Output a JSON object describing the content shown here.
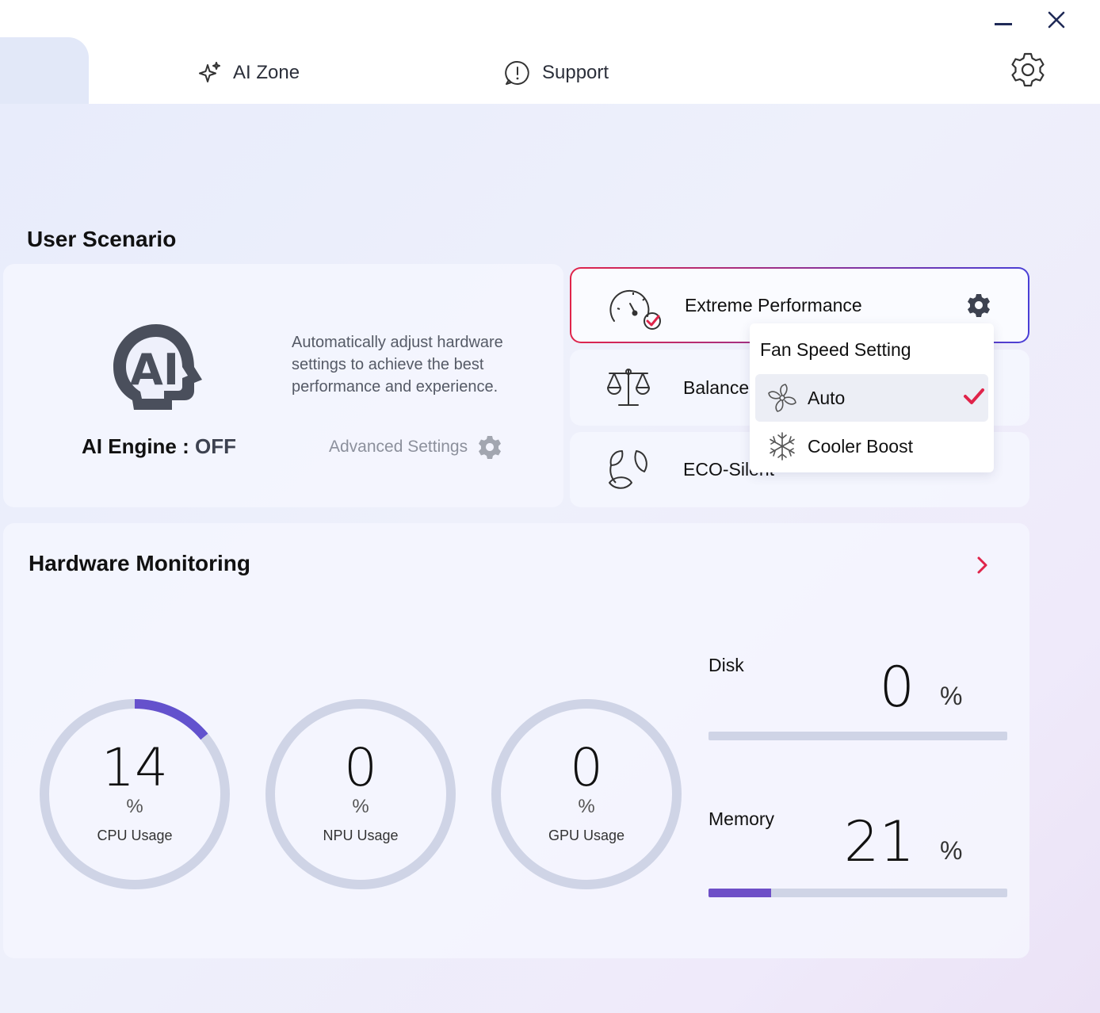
{
  "nav": {
    "tabs": [
      {
        "label": "AI Zone",
        "icon": "sparkle-icon"
      },
      {
        "label": "Support",
        "icon": "chat-alert-icon"
      }
    ]
  },
  "user_scenario": {
    "title": "User Scenario",
    "ai_engine": {
      "description": "Automatically adjust hardware settings to achieve the best performance and experience.",
      "label": "AI Engine",
      "separator": " : ",
      "state": "OFF",
      "advanced_settings_label": "Advanced Settings"
    },
    "modes": [
      {
        "label": "Extreme Performance",
        "icon": "speedometer-icon",
        "selected": true
      },
      {
        "label": "Balance",
        "icon": "scale-icon"
      },
      {
        "label": "ECO-Silent",
        "icon": "leaf-icon"
      }
    ],
    "fan_dropdown": {
      "title": "Fan Speed Setting",
      "options": [
        {
          "label": "Auto",
          "icon": "fan-icon",
          "selected": true
        },
        {
          "label": "Cooler Boost",
          "icon": "snowflake-icon"
        }
      ]
    }
  },
  "hardware_monitoring": {
    "title": "Hardware Monitoring",
    "gauges": [
      {
        "value": "14",
        "unit": "%",
        "name": "CPU Usage",
        "percent": 14
      },
      {
        "value": "0",
        "unit": "%",
        "name": "NPU Usage",
        "percent": 0
      },
      {
        "value": "0",
        "unit": "%",
        "name": "GPU Usage",
        "percent": 0
      }
    ],
    "disk": {
      "label": "Disk",
      "value": "0",
      "unit": "%",
      "percent": 0
    },
    "memory": {
      "label": "Memory",
      "value": "21",
      "unit": "%",
      "percent": 21
    }
  },
  "colors": {
    "accent_red": "#e0244a",
    "accent_purple": "#6e4fc7",
    "track": "#cfd4e6"
  }
}
